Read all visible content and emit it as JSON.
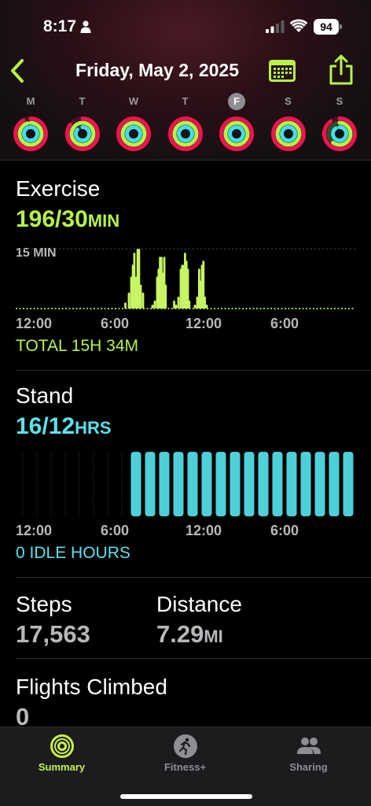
{
  "status_bar": {
    "time": "8:17",
    "battery": "94",
    "icons": [
      "person-icon",
      "signal-icon",
      "wifi-icon",
      "battery-icon"
    ]
  },
  "nav": {
    "title": "Friday, May 2, 2025",
    "icons": [
      "chevron-left-icon",
      "calendar-icon",
      "share-icon"
    ],
    "accent": "#b6f24a"
  },
  "week": {
    "days": [
      {
        "letter": "M",
        "selected": false,
        "move": 0.92,
        "exercise": 0.95,
        "stand": 1.0
      },
      {
        "letter": "T",
        "selected": false,
        "move": 0.85,
        "exercise": 1.0,
        "stand": 0.85
      },
      {
        "letter": "W",
        "selected": false,
        "move": 1.0,
        "exercise": 1.0,
        "stand": 1.0
      },
      {
        "letter": "T",
        "selected": false,
        "move": 1.0,
        "exercise": 1.0,
        "stand": 1.0
      },
      {
        "letter": "F",
        "selected": true,
        "move": 1.0,
        "exercise": 1.0,
        "stand": 1.0
      },
      {
        "letter": "S",
        "selected": false,
        "move": 1.0,
        "exercise": 1.0,
        "stand": 1.0
      },
      {
        "letter": "S",
        "selected": false,
        "move": 0.9,
        "exercise": 0.6,
        "stand": 0.9
      }
    ],
    "ring_colors": {
      "move": "#fa114f",
      "exercise": "#b6f24a",
      "stand": "#3ee0ec"
    }
  },
  "exercise": {
    "title": "Exercise",
    "value": "196/30",
    "unit": "MIN",
    "reference": "15 MIN",
    "total": "TOTAL 15H 34M",
    "color": "#b6f24a"
  },
  "stand": {
    "title": "Stand",
    "value": "16/12",
    "unit": "HRS",
    "idle": "0 IDLE HOURS",
    "color": "#5de0ea"
  },
  "axis": {
    "ticks": [
      "12:00",
      "6:00",
      "12:00",
      "6:00"
    ]
  },
  "metrics": {
    "steps_label": "Steps",
    "steps_value": "17,563",
    "distance_label": "Distance",
    "distance_value": "7.29",
    "distance_unit": "MI",
    "flights_label": "Flights Climbed",
    "flights_value": "0"
  },
  "tabs": [
    {
      "label": "Summary",
      "icon": "activity-rings-icon",
      "active": true
    },
    {
      "label": "Fitness+",
      "icon": "running-figure-icon",
      "active": false
    },
    {
      "label": "Sharing",
      "icon": "people-icon",
      "active": false
    }
  ],
  "chart_data": [
    {
      "type": "bar",
      "title": "Exercise",
      "x_unit": "minute of day",
      "y_unit": "minutes per interval",
      "reference_line": 15,
      "ylim": [
        0,
        16
      ],
      "xlim": [
        0,
        1440
      ],
      "values": [
        [
          0,
          0.3
        ],
        [
          30,
          0.3
        ],
        [
          60,
          0.3
        ],
        [
          90,
          0.3
        ],
        [
          120,
          0.3
        ],
        [
          150,
          0.3
        ],
        [
          180,
          0.3
        ],
        [
          210,
          0.3
        ],
        [
          240,
          0.3
        ],
        [
          270,
          0.3
        ],
        [
          300,
          0.3
        ],
        [
          330,
          0.3
        ],
        [
          360,
          0.3
        ],
        [
          390,
          0.3
        ],
        [
          420,
          0.3
        ],
        [
          450,
          0.8
        ],
        [
          465,
          1.5
        ],
        [
          480,
          4
        ],
        [
          490,
          8
        ],
        [
          497,
          11
        ],
        [
          503,
          14
        ],
        [
          510,
          8
        ],
        [
          517,
          15
        ],
        [
          523,
          15
        ],
        [
          530,
          6
        ],
        [
          540,
          4
        ],
        [
          550,
          0.5
        ],
        [
          560,
          0.5
        ],
        [
          570,
          0.5
        ],
        [
          580,
          1
        ],
        [
          590,
          2
        ],
        [
          600,
          8
        ],
        [
          606,
          10
        ],
        [
          612,
          13
        ],
        [
          618,
          13
        ],
        [
          624,
          9
        ],
        [
          630,
          13
        ],
        [
          636,
          6
        ],
        [
          642,
          0.5
        ],
        [
          648,
          0.5
        ],
        [
          660,
          0.5
        ],
        [
          672,
          2
        ],
        [
          680,
          1
        ],
        [
          690,
          3
        ],
        [
          700,
          10
        ],
        [
          706,
          11
        ],
        [
          712,
          11
        ],
        [
          718,
          14
        ],
        [
          724,
          12
        ],
        [
          730,
          10
        ],
        [
          736,
          2
        ],
        [
          742,
          0.5
        ],
        [
          750,
          0.5
        ],
        [
          760,
          1
        ],
        [
          770,
          3
        ],
        [
          778,
          10
        ],
        [
          784,
          7
        ],
        [
          790,
          11
        ],
        [
          796,
          12
        ],
        [
          802,
          3
        ],
        [
          810,
          1
        ],
        [
          820,
          0.5
        ],
        [
          840,
          0.5
        ],
        [
          870,
          0.5
        ],
        [
          900,
          0.5
        ],
        [
          930,
          0.5
        ],
        [
          960,
          0.5
        ],
        [
          990,
          0.5
        ],
        [
          1020,
          0.5
        ],
        [
          1050,
          0.5
        ],
        [
          1080,
          0.5
        ],
        [
          1110,
          0.5
        ],
        [
          1140,
          0.5
        ],
        [
          1170,
          0.5
        ],
        [
          1200,
          0.5
        ],
        [
          1230,
          0.5
        ],
        [
          1260,
          0.3
        ],
        [
          1290,
          0.3
        ],
        [
          1320,
          0.3
        ],
        [
          1350,
          0.3
        ],
        [
          1380,
          0.3
        ],
        [
          1410,
          0.3
        ]
      ]
    },
    {
      "type": "bar",
      "title": "Stand",
      "x_unit": "hour of day",
      "xlim": [
        0,
        24
      ],
      "stood_hours": [
        8,
        9,
        10,
        11,
        12,
        13,
        14,
        15,
        16,
        17,
        18,
        19,
        20,
        21,
        22,
        23
      ]
    }
  ]
}
